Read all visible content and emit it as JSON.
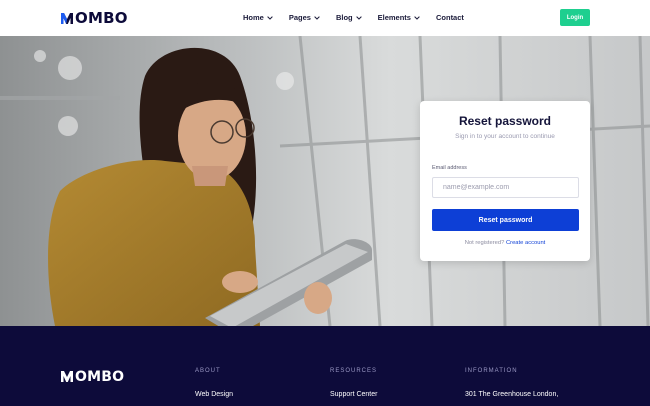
{
  "brand": {
    "name": "OMBO",
    "accent": "#1d5bf0"
  },
  "nav": {
    "items": [
      {
        "label": "Home",
        "has_dropdown": true
      },
      {
        "label": "Pages",
        "has_dropdown": true
      },
      {
        "label": "Blog",
        "has_dropdown": true
      },
      {
        "label": "Elements",
        "has_dropdown": true
      },
      {
        "label": "Contact",
        "has_dropdown": false
      }
    ],
    "login_label": "Login"
  },
  "card": {
    "title": "Reset password",
    "subtitle": "Sign in to your account to continue",
    "email_label": "Email address",
    "email_placeholder": "name@example.com",
    "email_value": "",
    "submit_label": "Reset password",
    "footer_text": "Not registered?",
    "footer_link": "Create account"
  },
  "footer": {
    "columns": [
      {
        "heading": "ABOUT",
        "first_item": "Web Design"
      },
      {
        "heading": "RESOURCES",
        "first_item": "Support Center"
      },
      {
        "heading": "INFORMATION",
        "first_item": "301 The Greenhouse London,"
      }
    ]
  },
  "colors": {
    "login": "#1ecf8f",
    "primary_button": "#0d3fd6",
    "footer_bg": "#0d0b3a"
  }
}
